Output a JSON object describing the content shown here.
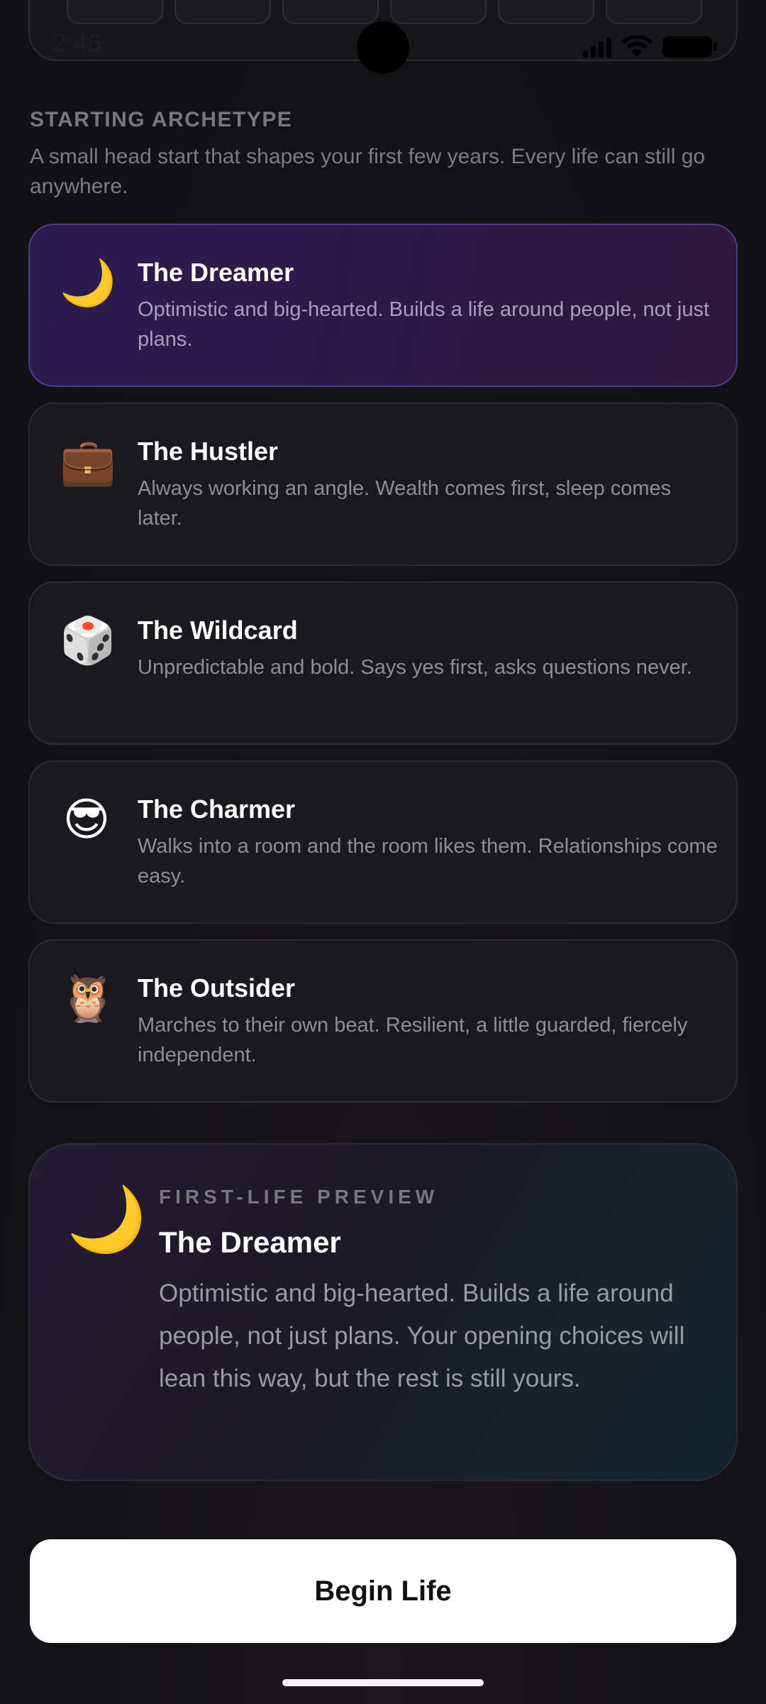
{
  "status_bar": {
    "time": "2:46",
    "icons": [
      "signal-icon",
      "wifi-icon",
      "battery-icon"
    ]
  },
  "section": {
    "title": "STARTING ARCHETYPE",
    "subtitle": "A small head start that shapes your first few years. Every life can still go anywhere."
  },
  "archetypes": [
    {
      "icon": "moon-icon",
      "emoji": "🌙",
      "name": "The Dreamer",
      "description": "Optimistic and big-hearted. Builds a life around people, not just plans.",
      "selected": true
    },
    {
      "icon": "briefcase-icon",
      "emoji": "💼",
      "name": "The Hustler",
      "description": "Always working an angle. Wealth comes first, sleep comes later.",
      "selected": false
    },
    {
      "icon": "dice-icon",
      "emoji": "🎲",
      "name": "The Wildcard",
      "description": "Unpredictable and bold. Says yes first, asks questions never.",
      "selected": false
    },
    {
      "icon": "sunglasses-face-icon",
      "emoji": "😎",
      "name": "The Charmer",
      "description": "Walks into a room and the room likes them. Relationships come easy.",
      "selected": false
    },
    {
      "icon": "owl-icon",
      "emoji": "🦉",
      "name": "The Outsider",
      "description": "Marches to their own beat. Resilient, a little guarded, fiercely independent.",
      "selected": false
    }
  ],
  "preview": {
    "icon": "moon-icon",
    "emoji": "🌙",
    "kicker": "FIRST-LIFE PREVIEW",
    "name": "The Dreamer",
    "description": "Optimistic and big-hearted. Builds a life around people, not just plans. Your opening choices will lean this way, but the rest is still yours."
  },
  "actions": {
    "begin_label": "Begin Life"
  },
  "colors": {
    "background": "#131317",
    "card": "#1a1a1e",
    "selected_card": "#2b1b4a",
    "selected_border": "#4d3d86",
    "primary_button": "#ffffff"
  }
}
